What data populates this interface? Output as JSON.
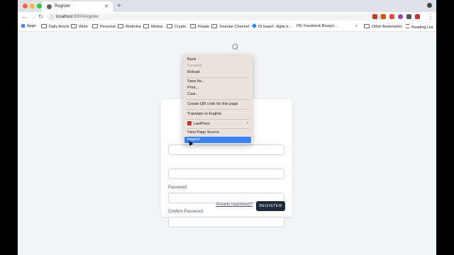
{
  "browser": {
    "tab_title": "Register",
    "url_host": "localhost",
    "url_path": ":8000/register",
    "icons": {
      "back": "arrow-left",
      "forward": "arrow-right",
      "reload": "reload",
      "lock": "info",
      "star": "star",
      "new_tab": "plus",
      "close": "x"
    }
  },
  "bookmarks": {
    "items": [
      "Apps",
      "Daily Article",
      "Work",
      "Personal",
      "Redmine",
      "Modus",
      "Crypto",
      "Reads",
      "Youtube Channel",
      "DI board - Agile b...",
      "FB: Facebook Bluepri..."
    ],
    "overflow": "»",
    "other": "Other Bookmarks",
    "reading_list": "Reading List"
  },
  "form": {
    "password_label": "Password",
    "confirm_label": "Confirm Password",
    "login_link": "Already registered?",
    "register_button": "REGISTER"
  },
  "context_menu": {
    "items": [
      "Back",
      "Forward",
      "Reload",
      "Save As...",
      "Print...",
      "Cast...",
      "Create QR code for this page",
      "Translate to English",
      "LastPass",
      "View Page Source",
      "Inspect"
    ]
  }
}
